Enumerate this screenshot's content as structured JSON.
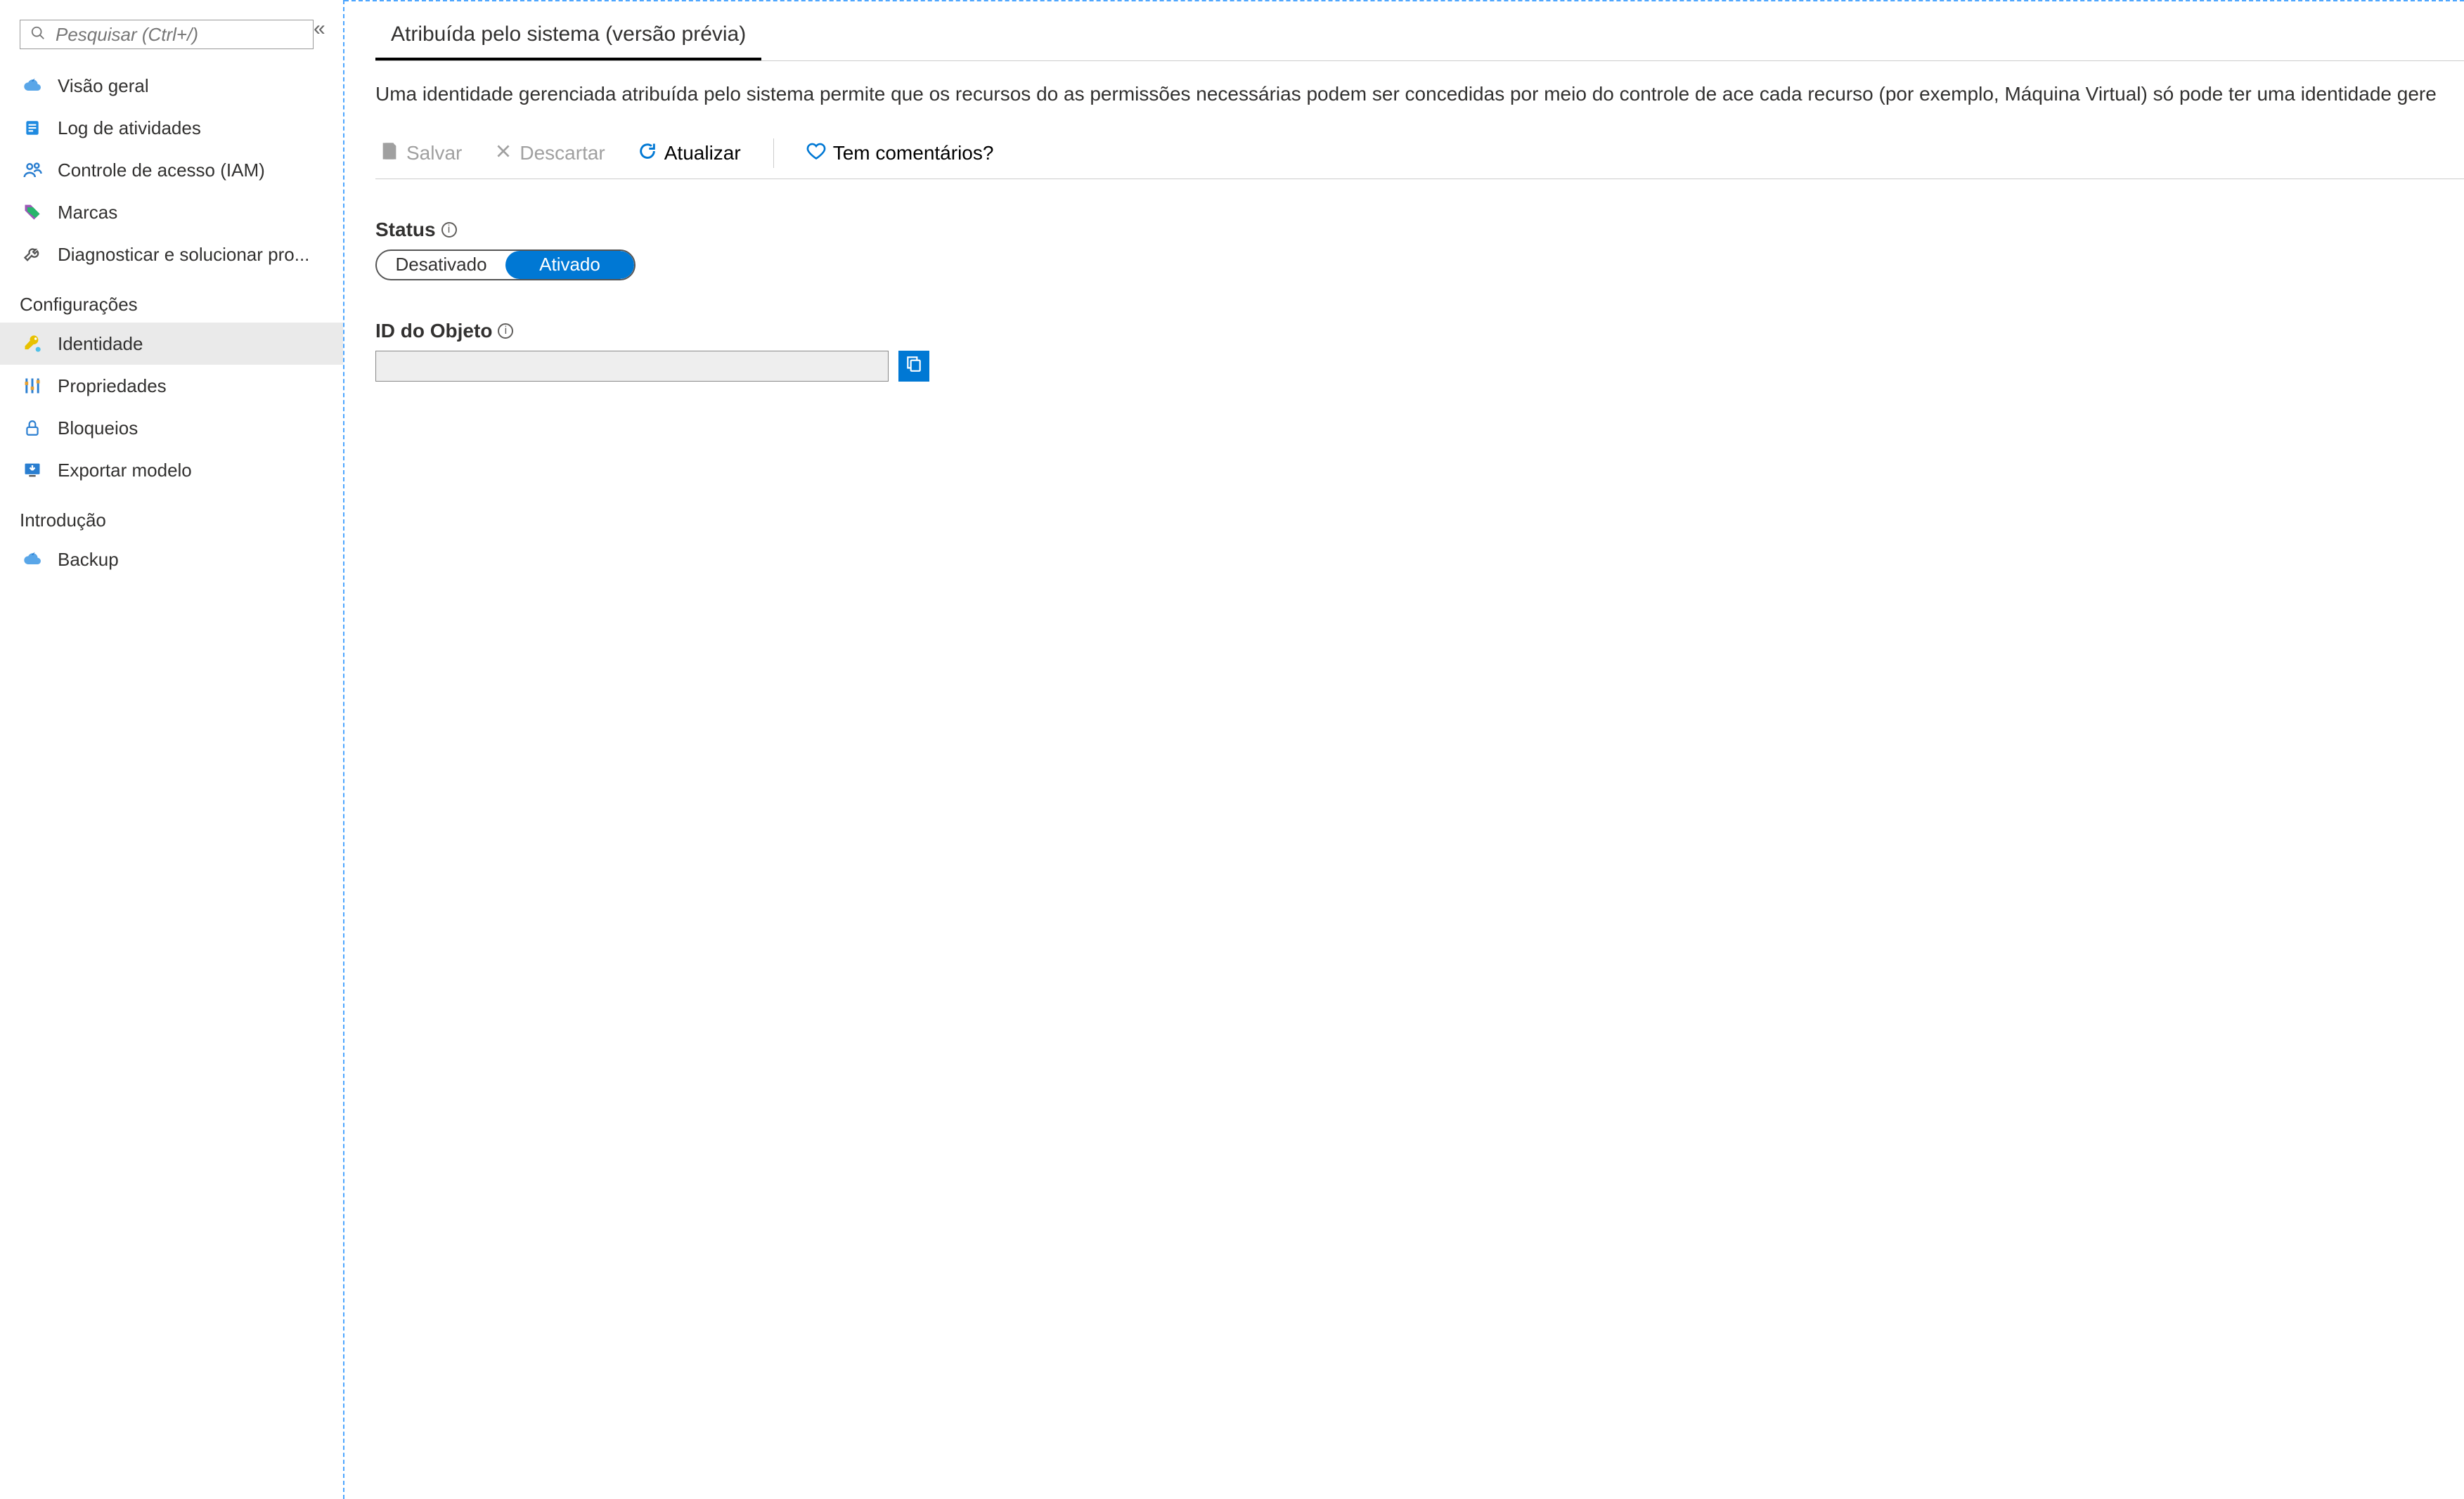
{
  "sidebar": {
    "search_placeholder": "Pesquisar (Ctrl+/)",
    "items": [
      {
        "label": "Visão geral",
        "icon": "cloud"
      },
      {
        "label": "Log de atividades",
        "icon": "log"
      },
      {
        "label": "Controle de acesso (IAM)",
        "icon": "people"
      },
      {
        "label": "Marcas",
        "icon": "tags"
      },
      {
        "label": "Diagnosticar e solucionar pro...",
        "icon": "wrench"
      }
    ],
    "section_settings": "Configurações",
    "settings_items": [
      {
        "label": "Identidade",
        "icon": "key",
        "active": true
      },
      {
        "label": "Propriedades",
        "icon": "sliders"
      },
      {
        "label": "Bloqueios",
        "icon": "lock"
      },
      {
        "label": "Exportar modelo",
        "icon": "export"
      }
    ],
    "section_intro": "Introdução",
    "intro_items": [
      {
        "label": "Backup",
        "icon": "cloud"
      }
    ]
  },
  "main": {
    "tab_label": "Atribuída pelo sistema (versão prévia)",
    "description": "Uma identidade gerenciada atribuída pelo sistema permite que os recursos do as permissões necessárias podem ser concedidas por meio do controle de ace cada recurso (por exemplo, Máquina Virtual) só pode ter uma identidade gere",
    "toolbar": {
      "save": "Salvar",
      "discard": "Descartar",
      "refresh": "Atualizar",
      "feedback": "Tem comentários?"
    },
    "status": {
      "label": "Status",
      "off": "Desativado",
      "on": "Ativado"
    },
    "object_id": {
      "label": "ID do Objeto",
      "value": ""
    }
  }
}
